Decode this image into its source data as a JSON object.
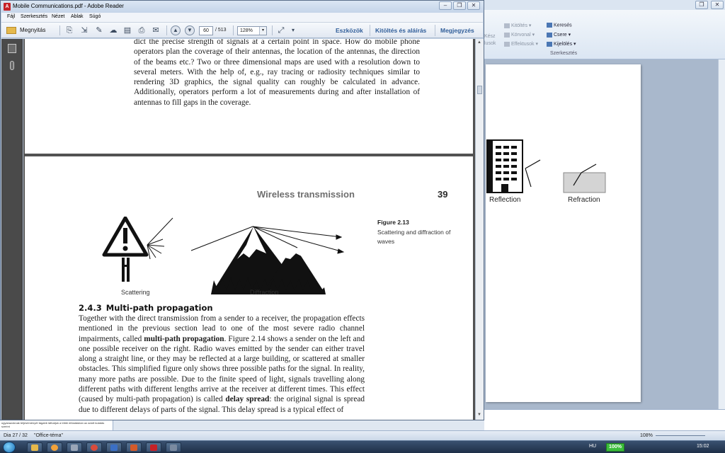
{
  "reader": {
    "title": "Mobile Communications.pdf - Adobe Reader",
    "menu": [
      "Fájl",
      "Szerkesztés",
      "Nézet",
      "Ablak",
      "Súgó"
    ],
    "toolbar": {
      "open_label": "Megnyitás",
      "current_page": "60",
      "total_pages": "/ 513",
      "zoom": "128%",
      "tools_label": "Eszközök",
      "fill_sign_label": "Kitöltés és aláírás",
      "comment_label": "Megjegyzés"
    },
    "document": {
      "top_paragraph": "dict the precise strength of signals at a certain point in space. How do mobile phone operators plan the coverage of their antennas, the location of the antennas, the direction of the beams etc.? Two or three dimensional maps are used with a resolution down to several meters. With the help of, e.g., ray tracing or radiosity techniques similar to rendering 3D graphics, the signal quality can roughly be calculated in advance. Additionally, operators perform a lot of measurements during and after installation of antennas to fill gaps in the coverage.",
      "running_head": "Wireless transmission",
      "page_number": "39",
      "figure_caption_title": "Figure 2.13",
      "figure_caption_text": "Scattering and diffraction of waves",
      "figure_labels": {
        "scattering": "Scattering",
        "diffraction": "Diffraction"
      },
      "section_number": "2.4.3",
      "section_title": "Multi-path propagation",
      "section_paragraph_parts": {
        "p1": "Together with the direct transmission from a sender to a receiver, the propagation effects mentioned in the previous section lead to one of the most severe radio channel impairments, called ",
        "term1": "multi-path propagation",
        "p2": ". Figure 2.14 shows a sender on the left and one possible receiver on the right. Radio waves emitted by the sender can either travel along a straight line, or they may be reflected at a large building, or scattered at smaller obstacles. This simplified figure only shows three possible paths for the signal. In reality, many more paths are possible. Due to the finite speed of light, signals travelling along different paths with different lengths arrive at the receiver at different times. This effect (caused by multi-path propagation) is called ",
        "term2": "delay spread",
        "p3": ": the original signal is spread due to different delays of parts of the signal. This delay spread is a typical effect of"
      }
    }
  },
  "powerpoint": {
    "ribbon": {
      "kitoltes": "Kitöltés",
      "korvonal": "Körvonal",
      "effektusok": "Effektusok",
      "keszlet_top": "Kész",
      "keszlet_bottom": "lusok",
      "kereses": "Keresés",
      "csere": "Csere",
      "kijeloles": "Kijelölés",
      "group_label": "Szerkesztés"
    },
    "slide_labels": {
      "reflection": "Reflection",
      "refraction": "Refraction"
    },
    "status": {
      "slide_counter": "Dia 27 / 32",
      "theme": "\"Office-téma\"",
      "zoom": "108%",
      "notes_snippet": "ugyanazoknak teljesítményét tágabb láthatjuk a többi előadásban az adott kutatás szerint"
    }
  },
  "taskbar": {
    "language": "HU",
    "battery": "100%",
    "clock": "15:02"
  }
}
